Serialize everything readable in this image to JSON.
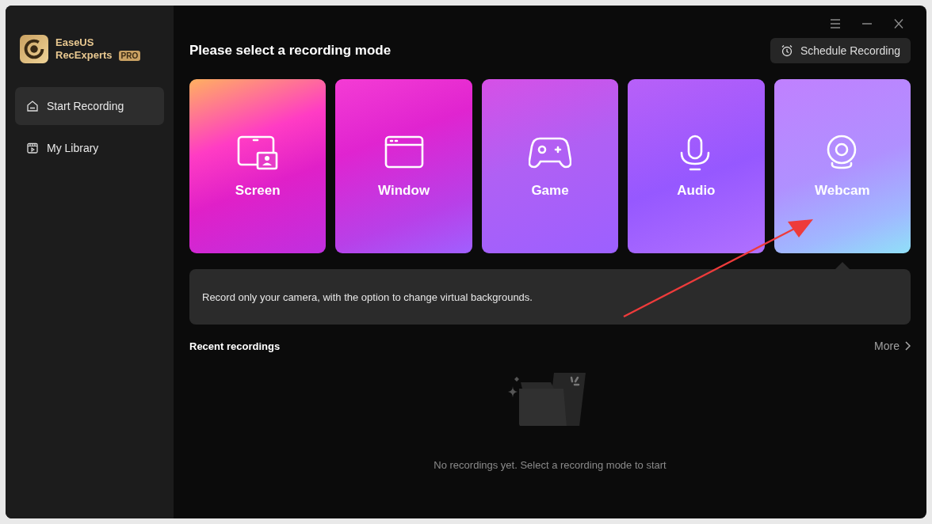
{
  "app": {
    "name_line1": "EaseUS",
    "name_line2": "RecExperts",
    "badge": "PRO"
  },
  "sidebar": {
    "items": [
      {
        "label": "Start Recording",
        "selected": true
      },
      {
        "label": "My Library",
        "selected": false
      }
    ]
  },
  "main": {
    "title": "Please select a recording mode",
    "schedule_button": "Schedule Recording",
    "modes": [
      {
        "label": "Screen",
        "selected": false
      },
      {
        "label": "Window",
        "selected": false
      },
      {
        "label": "Game",
        "selected": false
      },
      {
        "label": "Audio",
        "selected": false
      },
      {
        "label": "Webcam",
        "selected": true
      }
    ],
    "description": "Record only your camera, with the option to change virtual backgrounds.",
    "recent": {
      "title": "Recent recordings",
      "more": "More",
      "empty": "No recordings yet. Select a recording mode to start"
    }
  }
}
